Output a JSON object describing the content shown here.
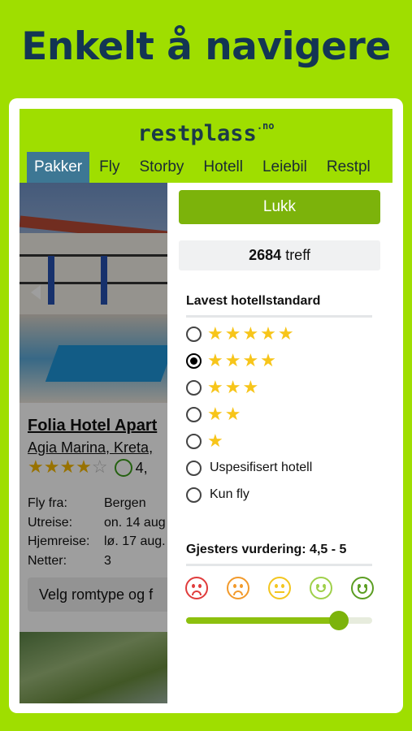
{
  "headline": "Enkelt å navigere",
  "app": {
    "logo": "restplass",
    "logo_suffix": ".no",
    "tabs": [
      "Pakker",
      "Fly",
      "Storby",
      "Hotell",
      "Leiebil",
      "Restpl"
    ],
    "active_tab": "Pakker"
  },
  "listing": {
    "hotel_name": "Folia Hotel Apart",
    "location": "Agia Marina, Kreta,",
    "stars": 4,
    "score_partial": "4,",
    "details": [
      {
        "label": "Fly fra:",
        "value": "Bergen"
      },
      {
        "label": "Utreise:",
        "value": "on. 14 aug"
      },
      {
        "label": "Hjemreise:",
        "value": "lø. 17 aug."
      },
      {
        "label": "Netter:",
        "value": "3"
      }
    ],
    "choose_button": "Velg romtype og f"
  },
  "filter": {
    "close_button": "Lukk",
    "count_number": "2684",
    "count_label": "treff",
    "standard_title": "Lavest hotellstandard",
    "standard_options": [
      {
        "stars": "★★★★★",
        "label": "",
        "selected": false
      },
      {
        "stars": "★★★★",
        "label": "",
        "selected": true
      },
      {
        "stars": "★★★",
        "label": "",
        "selected": false
      },
      {
        "stars": "★★",
        "label": "",
        "selected": false
      },
      {
        "stars": "★",
        "label": "",
        "selected": false
      },
      {
        "stars": "",
        "label": "Uspesifisert hotell",
        "selected": false
      },
      {
        "stars": "",
        "label": "Kun fly",
        "selected": false
      }
    ],
    "guest_title": "Gjesters vurdering: 4,5 - 5",
    "faces": [
      {
        "icon": "very-sad-face-icon",
        "color": "#e03c3c"
      },
      {
        "icon": "sad-face-icon",
        "color": "#f29a2b"
      },
      {
        "icon": "neutral-face-icon",
        "color": "#f3c61f"
      },
      {
        "icon": "smile-face-icon",
        "color": "#9fd04a"
      },
      {
        "icon": "happy-face-icon",
        "color": "#5b9d22"
      }
    ],
    "slider_value": 0.82
  },
  "colors": {
    "brand_green": "#9fde00",
    "button_green": "#7cb30b",
    "tab_active": "#3d7794",
    "headline": "#133553"
  }
}
